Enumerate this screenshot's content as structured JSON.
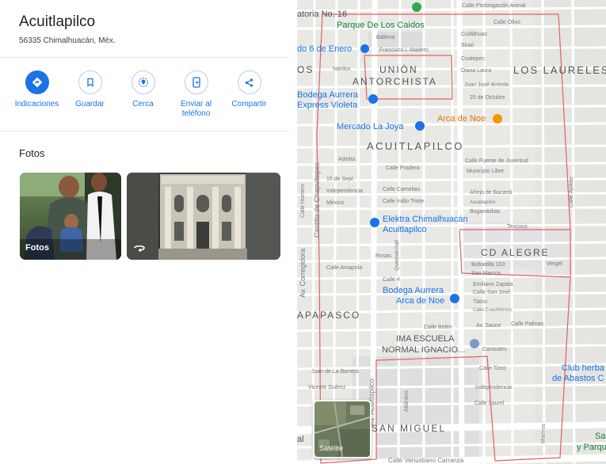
{
  "place": {
    "name": "Acuitlapilco",
    "address": "56335 Chimalhuacán, Méx."
  },
  "actions": [
    {
      "icon": "directions-icon",
      "label": "Indicaciones"
    },
    {
      "icon": "bookmark-icon",
      "label": "Guardar"
    },
    {
      "icon": "nearby-icon",
      "label": "Cerca"
    },
    {
      "icon": "send-to-phone-icon",
      "label": "Enviar al teléfono"
    },
    {
      "icon": "share-icon",
      "label": "Compartir"
    }
  ],
  "photos": {
    "heading": "Fotos",
    "first_label": "Fotos",
    "second_icon": "360-view-icon"
  },
  "map": {
    "satellite_label": "Satélite",
    "streets": {
      "s1": "Calle Prolongación Arenal",
      "s2": "Calle Olivo",
      "s3": "Ballena",
      "s4": "Francisco I. Madero",
      "s5": "Cuitláhuac",
      "s6": "Sinaí",
      "s7": "Nardos",
      "s8": "Coatepec",
      "s9": "Diana Laura",
      "s10": "Juan José Arreola",
      "s11": "25 de Octubre",
      "s12": "Adelita",
      "s13": "Calle Pradera",
      "s14": "Calle Fuente de Juventud",
      "s15": "Municipio Libre",
      "s16": "15 de Sept.",
      "s17": "Independencia",
      "s18": "México",
      "s19": "Calle Camelias",
      "s20": "Calle Indio Triste",
      "s21": "Añejo de Bacardi",
      "s22": "Acuatlapilco",
      "s23": "Bugambilias",
      "s24": "Texcoco",
      "s25": "Calle Homero",
      "s26": "Castillo de Chapultepec",
      "s27": "Rosas",
      "s28": "Calle Amapola",
      "s29": "Quetzalcóatl",
      "s30": "Calle 4",
      "s31": "Bobadilla 103",
      "s32": "San Marcos",
      "s33": "Emiliano Zapata",
      "s34": "Calle San José",
      "s35": "Tlaloc",
      "s36": "Calle Cuauhtémoc",
      "s37": "Av. Corregidora",
      "s38": "Calle Belén",
      "s39": "Av. Sauce",
      "s40": "Calle Palmas",
      "s41": "Canizales",
      "s42": "Calle Tizoc",
      "s43": "Juan de La Barrera",
      "s44": "Vicente Suárez",
      "s45": "Av. Acuitlapilco",
      "s46": "Atlántico",
      "s47": "Independencia",
      "s48": "Calle Laurel",
      "s49": "Marinos",
      "s50": "Vergel",
      "s51": "Calle Venustiano Carranza",
      "s52": "Calle Ajolote"
    },
    "labels": {
      "top_left": "atoria No. 16",
      "parque": "Parque De Los Caidos",
      "enero": "do 6 de Enero",
      "union1": "UNIÓN",
      "union2": "ANTORCHISTA",
      "laureles": "LOS LAURELES",
      "os": "OS",
      "bodega1": "Bodega Aurrera",
      "bodega1b": "Express Violeta",
      "arca": "Arca de Noe",
      "mercado": "Mercado La Joya",
      "acuitlapilco": "ACUITLAPILCO",
      "elektra1": "Elektra Chimalhuacán",
      "elektra2": "Acuitlapilco",
      "cdalegre": "CD ALEGRE",
      "bodega2": "Bodega Aurrera",
      "bodega2b": "Arca de Noe",
      "apapasco": "APAPASCO",
      "ima1": "IMA ESCUELA",
      "ima2": "NORMAL IGNACIO...",
      "club1": "Club herba",
      "club2": "de Abastos C",
      "sanmiguel": "SAN MIGUEL",
      "al": "al",
      "sa": "Sa",
      "parqu": "y Parqu"
    }
  }
}
